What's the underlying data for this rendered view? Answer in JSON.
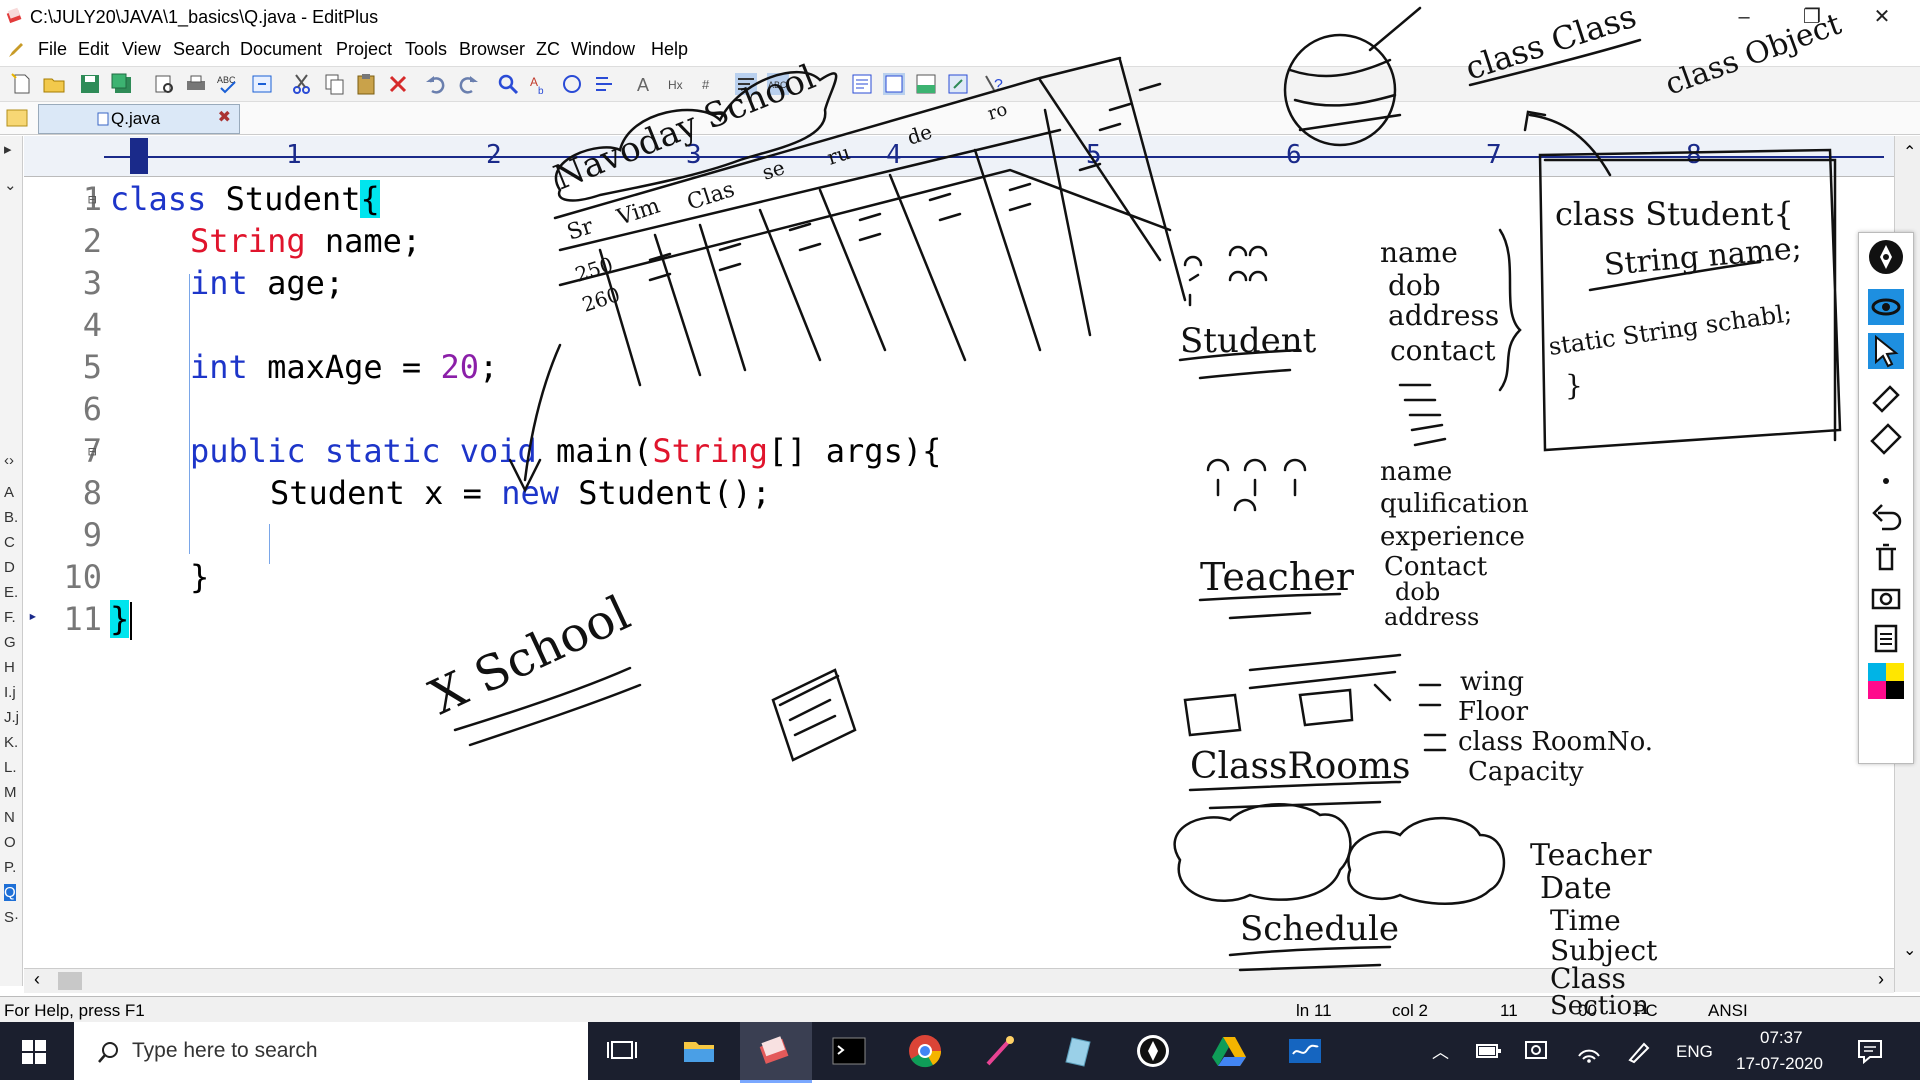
{
  "window": {
    "title": "C:\\JULY20\\JAVA\\1_basics\\Q.java - EditPlus",
    "controls": {
      "minimize": "–",
      "restore": "❐",
      "close": "✕"
    }
  },
  "menu": [
    "File",
    "Edit",
    "View",
    "Search",
    "Document",
    "Project",
    "Tools",
    "Browser",
    "ZC",
    "Window",
    "Help"
  ],
  "tab": {
    "label": "Q.java",
    "close": "✖"
  },
  "ruler": {
    "marks": [
      "1",
      "2",
      "3",
      "4",
      "5",
      "6",
      "7",
      "8"
    ]
  },
  "left_index": [
    "A",
    "B.",
    "C",
    "D",
    "E.",
    "F.",
    "G",
    "H",
    "I.j",
    "J.j",
    "K.",
    "L.",
    "M",
    "N",
    "O",
    "P.",
    "Q",
    "S·"
  ],
  "editor": {
    "line_numbers": [
      "1",
      "2",
      "3",
      "4",
      "5",
      "6",
      "7",
      "8",
      "9",
      "10",
      "11"
    ],
    "code": {
      "l1_kw": "class",
      "l1_rest": " Student",
      "l1_brace": "{",
      "l2_type": "String",
      "l2_rest": " name;",
      "l3_kw": "int",
      "l3_rest": " age;",
      "l5_kw": "int",
      "l5_mid": " maxAge = ",
      "l5_num": "20",
      "l5_end": ";",
      "l7_kw": "public static void",
      "l7_mid": " main(",
      "l7_type": "String",
      "l7_end": "[] args){",
      "l8_text": "Student x = ",
      "l8_kw": "new",
      "l8_end": " Student();",
      "l10": "}",
      "l11": "}"
    }
  },
  "status": {
    "help": "For Help, press F1",
    "line": "ln 11",
    "col": "col 2",
    "count": "11",
    "mode": "00",
    "pc": "PC",
    "encoding": "ANSI"
  },
  "taskbar": {
    "search_placeholder": "Type here to search",
    "language": "ENG",
    "time": "07:37",
    "date": "17-07-2020"
  },
  "annotations": {
    "school_cloud": "Navoday School",
    "table_headers": [
      "Sr",
      "Vim",
      "Clas",
      "se",
      "ru",
      "de",
      "ro"
    ],
    "table_rows": [
      "250",
      "260"
    ],
    "x_school": "X School",
    "class_class": "class Class",
    "class_object": "class Object",
    "student_label": "Student",
    "student_props": [
      "name",
      "dob",
      "address",
      "contact"
    ],
    "teacher_label": "Teacher",
    "teacher_props": [
      "name",
      "qulification",
      "experience",
      "Contact",
      "dob",
      "address"
    ],
    "classroom_label": "ClassRooms",
    "classroom_props": [
      "wing",
      "Floor",
      "class RoomNo.",
      "Capacity"
    ],
    "schedule_label": "Schedule",
    "schedule_props": [
      "Teacher",
      "Date",
      "Time",
      "Subject",
      "Class",
      "Section"
    ],
    "box_code": [
      "class Student{",
      "String name;",
      "static String schabl;",
      "}"
    ]
  },
  "colors": {
    "keyword": "#1d35c9",
    "type": "#e0142c",
    "number": "#8b1fa8",
    "highlight": "#00e5ee",
    "ruler": "#1a2a8a"
  }
}
